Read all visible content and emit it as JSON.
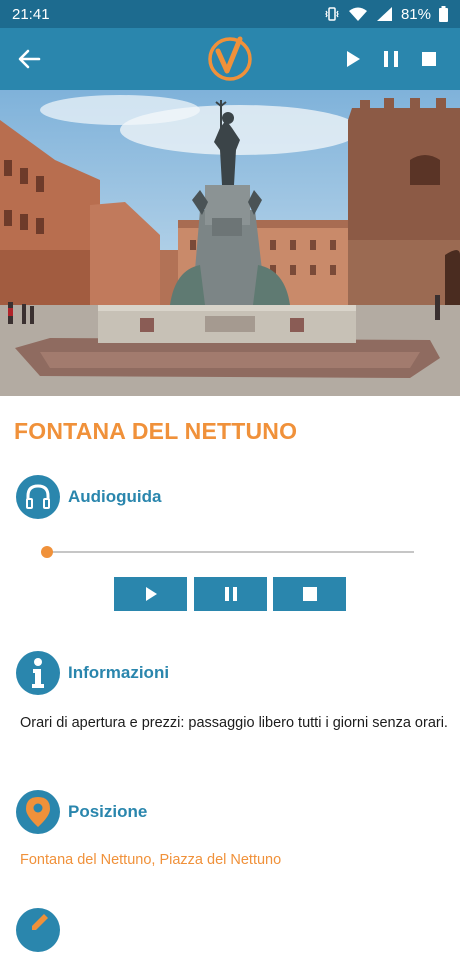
{
  "status": {
    "time": "21:41",
    "battery": "81%"
  },
  "toolbar": {
    "back_icon": "arrow-left-icon",
    "logo_icon": "v-logo-icon",
    "play_icon": "play-icon",
    "pause_icon": "pause-icon",
    "stop_icon": "stop-icon"
  },
  "place": {
    "title": "FONTANA DEL NETTUNO"
  },
  "audioguide": {
    "label": "Audioguida",
    "icon": "headphones-icon",
    "progress": 0,
    "buttons": [
      "play",
      "pause",
      "stop"
    ]
  },
  "info": {
    "label": "Informazioni",
    "icon": "info-icon",
    "text": "Orari di apertura e prezzi: passaggio libero tutti i giorni senza orari."
  },
  "position": {
    "label": "Posizione",
    "icon": "location-pin-icon",
    "address": "Fontana del Nettuno, Piazza del Nettuno"
  },
  "colors": {
    "status_bar": "#1d6b8f",
    "primary": "#2a86ad",
    "accent": "#f0913a"
  }
}
